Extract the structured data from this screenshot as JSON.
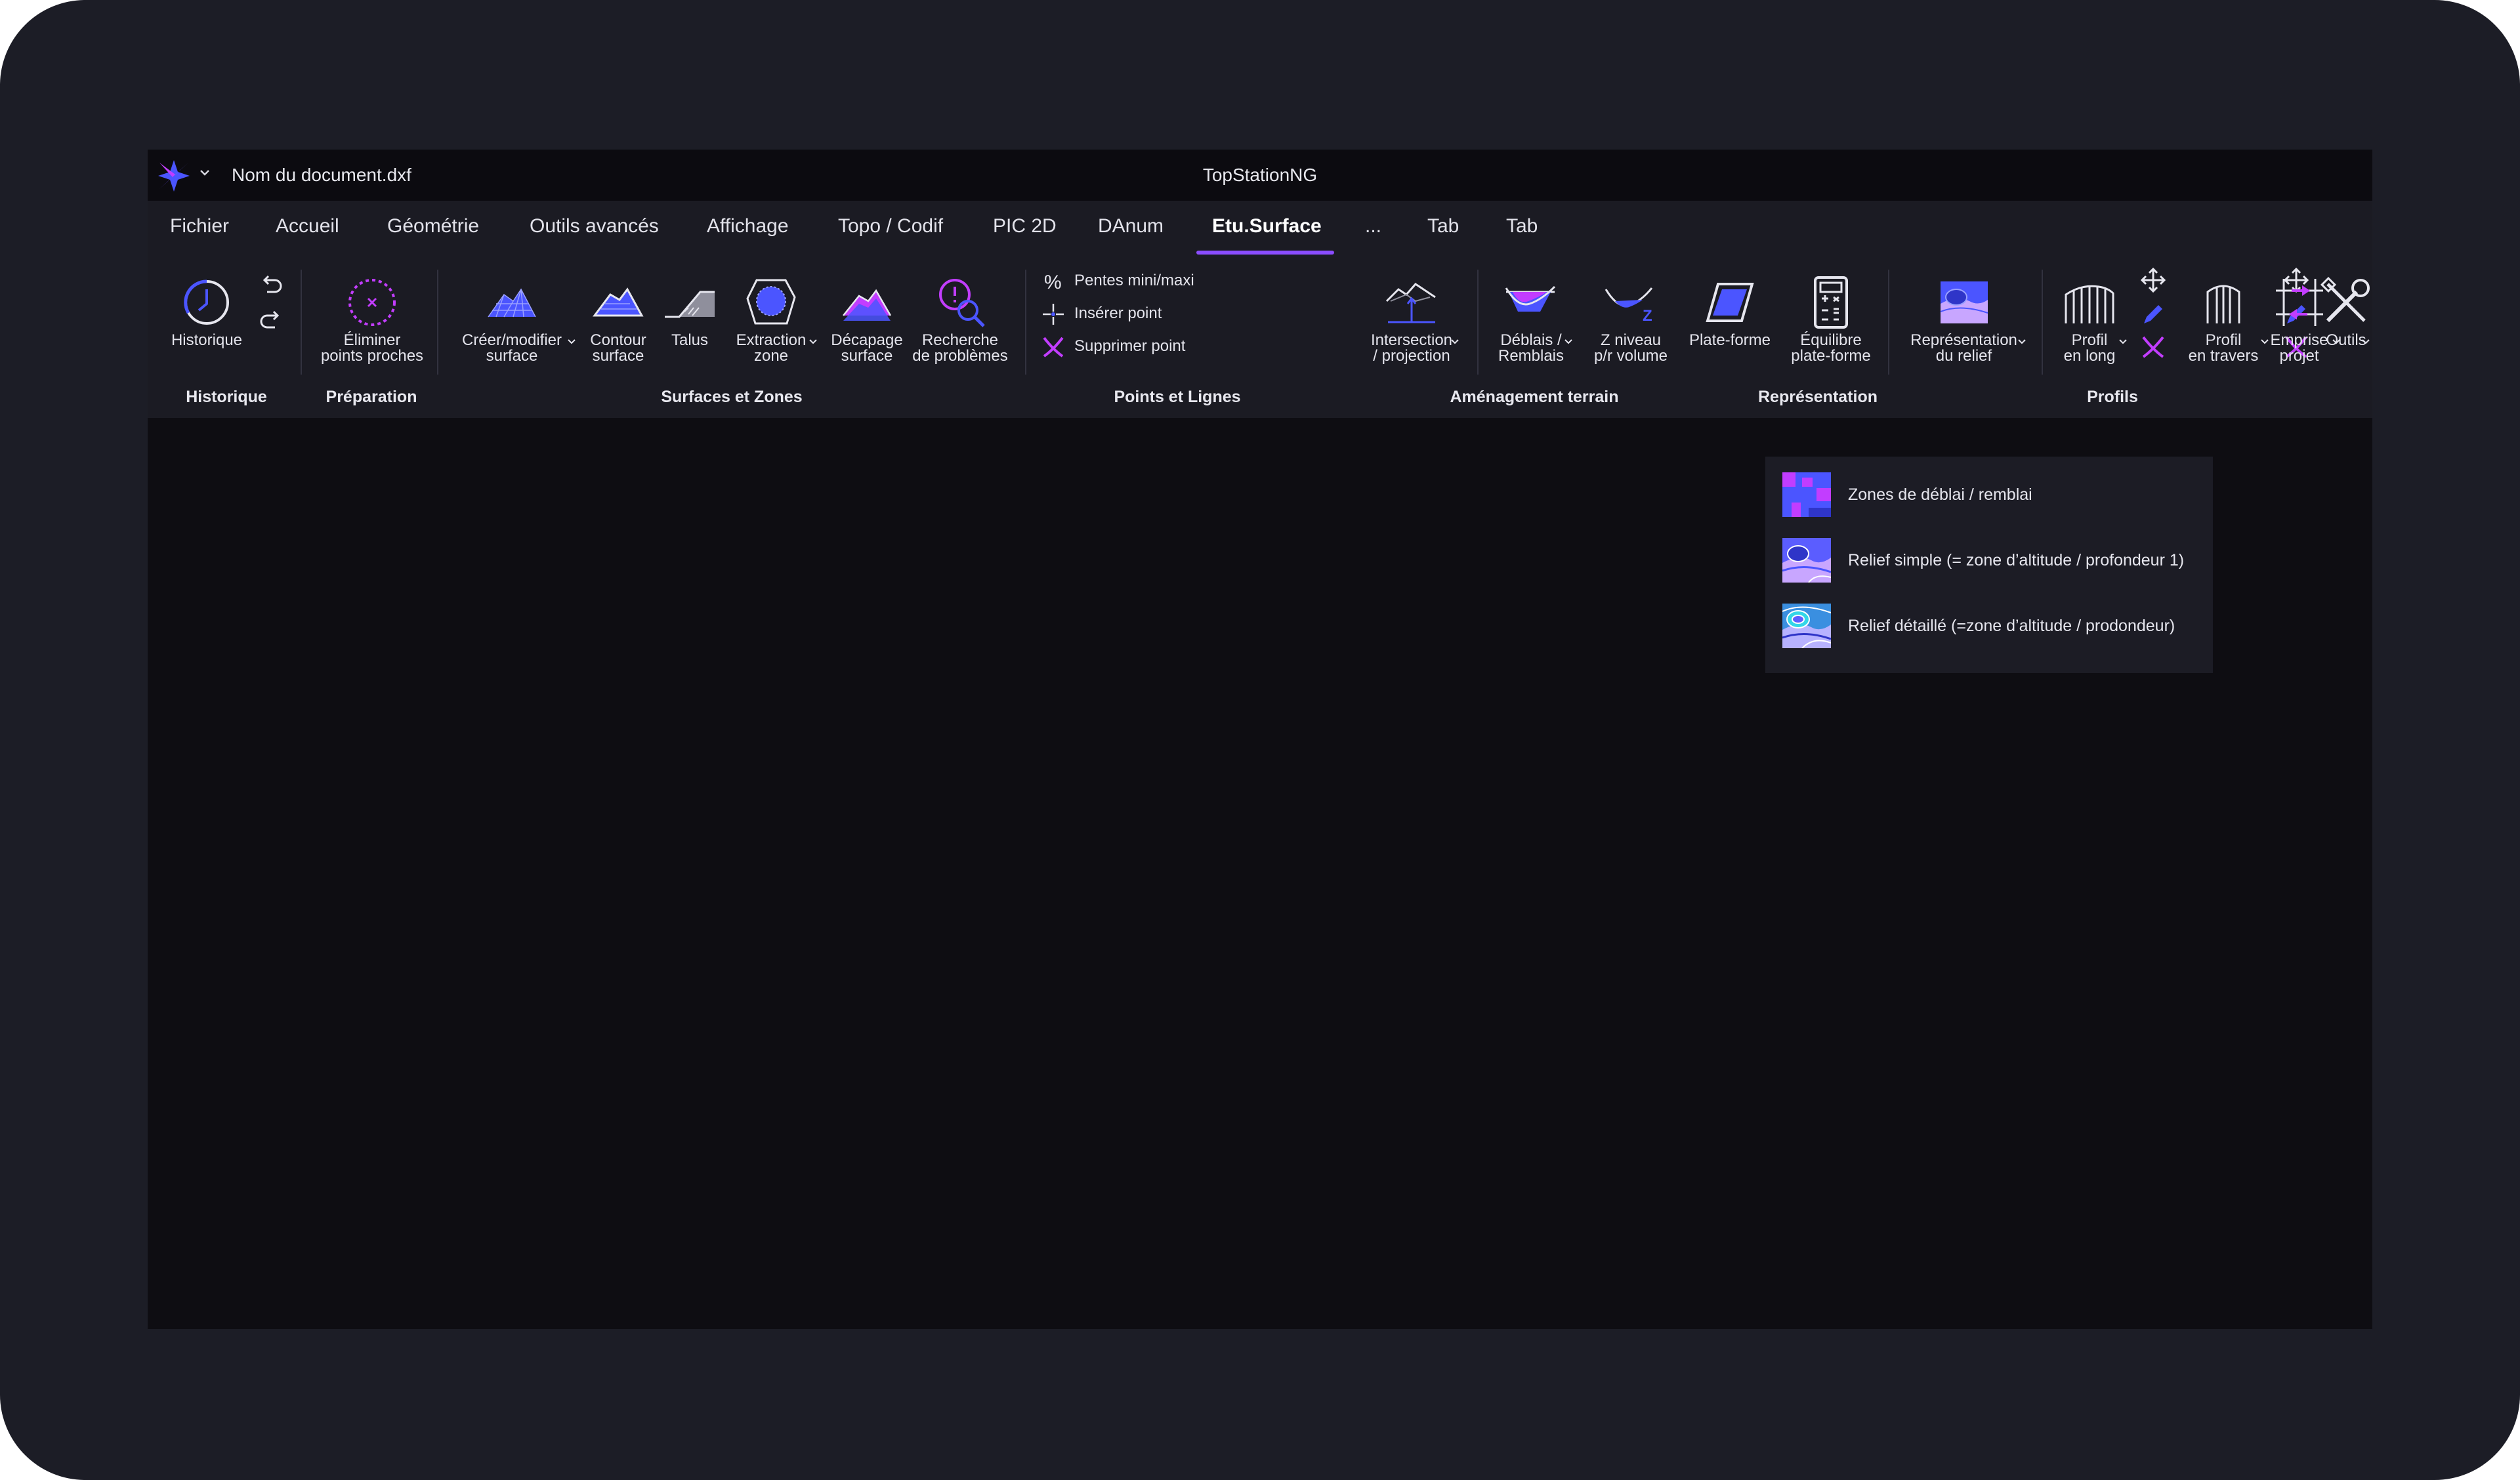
{
  "titlebar": {
    "document_name": "Nom du document.dxf",
    "app_title": "TopStationNG"
  },
  "tabs": [
    {
      "label": "Fichier"
    },
    {
      "label": "Accueil"
    },
    {
      "label": "Géométrie"
    },
    {
      "label": "Outils avancés"
    },
    {
      "label": "Affichage"
    },
    {
      "label": "Topo / Codif"
    },
    {
      "label": "PIC 2D"
    },
    {
      "label": "DAnum"
    },
    {
      "label": "Etu.Surface",
      "active": true
    },
    {
      "label": "..."
    },
    {
      "label": "Tab"
    },
    {
      "label": "Tab"
    }
  ],
  "ribbon": {
    "buttons": {
      "historique": "Historique",
      "eliminer": "Éliminer\npoints proches",
      "creer_modifier": "Créer/modifier\nsurface",
      "contour": "Contour\nsurface",
      "talus": "Talus",
      "extraction": "Extraction\nzone",
      "decapage": "Décapage\nsurface",
      "recherche": "Recherche\nde problèmes",
      "intersection": "Intersection\n/ projection",
      "deblais": "Déblais /\nRemblais",
      "z_niveau": "Z niveau\np/r volume",
      "plate_forme": "Plate-forme",
      "equilibre": "Équilibre\nplate-forme",
      "representation": "Représentation\ndu relief",
      "profil_long": "Profil\nen long",
      "profil_travers": "Profil\nen travers",
      "outils": "Outils",
      "emprise": "Emprise\nprojet"
    },
    "small_buttons": {
      "pentes": "Pentes mini/maxi",
      "inserer": "Insérer point",
      "supprimer": "Supprimer point"
    },
    "groups": {
      "historique": "Historique",
      "preparation": "Préparation",
      "surfaces": "Surfaces et Zones",
      "points": "Points et Lignes",
      "amenagement": "Aménagement terrain",
      "representation": "Représentation",
      "profils": "Profils"
    }
  },
  "dropdown": {
    "items": [
      {
        "label": "Zones de déblai / remblai"
      },
      {
        "label": "Relief simple (= zone d’altitude / profondeur 1)"
      },
      {
        "label": "Relief détaillé (=zone d’altitude / prodondeur)"
      }
    ]
  },
  "colors": {
    "accent_purple": "#8b4dff",
    "accent_blue": "#4b55ff",
    "magenta": "#c23dff",
    "background": "#0e0d12",
    "ribbon": "#1b1b23"
  }
}
